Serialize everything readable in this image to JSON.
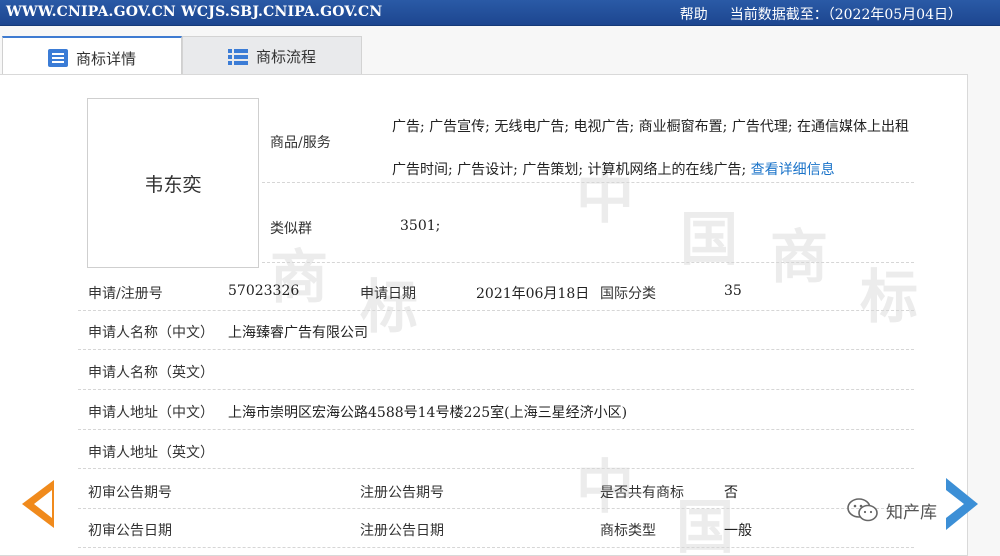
{
  "topbar": {
    "domains": "WWW.CNIPA.GOV.CN WCJS.SBJ.CNIPA.GOV.CN",
    "help": "帮助",
    "data_as_of": "当前数据截至：（2022年05月04日）"
  },
  "tabs": [
    {
      "label": "商标详情",
      "active": true
    },
    {
      "label": "商标流程",
      "active": false
    }
  ],
  "watermark": [
    "中",
    "国",
    "商",
    "标"
  ],
  "trademark": {
    "name": "韦东奕",
    "goods_label": "商品/服务",
    "goods_text": "广告; 广告宣传; 无线电广告; 电视广告; 商业橱窗布置; 广告代理; 在通信媒体上出租广告时间; 广告设计; 广告策划; 计算机网络上的在线广告; ",
    "goods_link": "查看详细信息",
    "similar_group_label": "类似群",
    "similar_group_value": "3501;"
  },
  "rows": {
    "reg_no_label": "申请/注册号",
    "reg_no": "57023326",
    "apply_date_label": "申请日期",
    "apply_date": "2021年06月18日",
    "intl_class_label": "国际分类",
    "intl_class": "35",
    "applicant_cn_label": "申请人名称（中文）",
    "applicant_cn": "上海臻睿广告有限公司",
    "applicant_en_label": "申请人名称（英文）",
    "applicant_en": "",
    "address_cn_label": "申请人地址（中文）",
    "address_cn": "上海市崇明区宏海公路4588号14号楼225室(上海三星经济小区)",
    "address_en_label": "申请人地址（英文）",
    "address_en": "",
    "prelim_pub_no_label": "初审公告期号",
    "prelim_pub_no": "",
    "reg_pub_no_label": "注册公告期号",
    "reg_pub_no": "",
    "shared_label": "是否共有商标",
    "shared": "否",
    "prelim_pub_date_label": "初审公告日期",
    "prelim_pub_date": "",
    "reg_pub_date_label": "注册公告日期",
    "reg_pub_date": "",
    "tm_type_label": "商标类型",
    "tm_type": "一般"
  },
  "badge": {
    "text": "知产库"
  },
  "colors": {
    "topbar": "#1d4690",
    "accent": "#3b7cd6",
    "link": "#1a73c9",
    "prev_arrow": "#f08a1c",
    "next_arrow": "#3c8fd6"
  }
}
